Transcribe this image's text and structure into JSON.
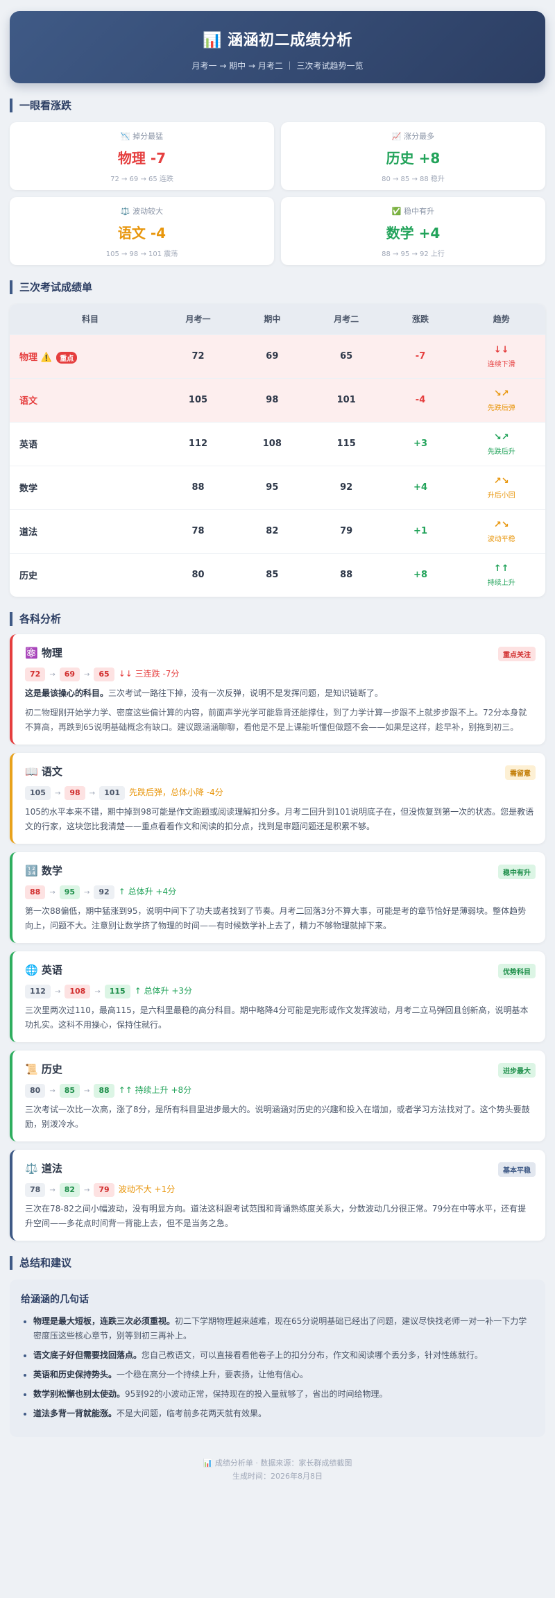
{
  "header": {
    "icon": "📊",
    "title": "涵涵初二成绩分析",
    "subtitle": "月考一 → 期中 → 月考二 ｜ 三次考试趋势一览"
  },
  "sections": {
    "overview": "一眼看涨跌",
    "table": "三次考试成绩单",
    "analysis": "各科分析",
    "summary": "总结和建议"
  },
  "stats": [
    {
      "icon": "📉",
      "label": "掉分最猛",
      "value": "物理 -7",
      "detail": "72 → 69 → 65 连跌",
      "color": "red"
    },
    {
      "icon": "📈",
      "label": "涨分最多",
      "value": "历史 +8",
      "detail": "80 → 85 → 88 稳升",
      "color": "green"
    },
    {
      "icon": "⚖️",
      "label": "波动较大",
      "value": "语文 -4",
      "detail": "105 → 98 → 101 震荡",
      "color": "orange"
    },
    {
      "icon": "✅",
      "label": "稳中有升",
      "value": "数学 +4",
      "detail": "88 → 95 → 92 上行",
      "color": "green"
    }
  ],
  "table": {
    "headers": [
      "科目",
      "月考一",
      "期中",
      "月考二",
      "涨跌",
      "趋势"
    ],
    "rows": [
      {
        "subject": "物理 ⚠️",
        "badge": "重点",
        "s1": "72",
        "s2": "69",
        "s3": "65",
        "change": "-7",
        "arrow": "↓↓",
        "trend": "连续下滑",
        "color": "red",
        "highlight": true
      },
      {
        "subject": "语文",
        "badge": "",
        "s1": "105",
        "s2": "98",
        "s3": "101",
        "change": "-4",
        "arrow": "↘↗",
        "trend": "先跌后弹",
        "color": "orange",
        "highlight": true
      },
      {
        "subject": "英语",
        "badge": "",
        "s1": "112",
        "s2": "108",
        "s3": "115",
        "change": "+3",
        "arrow": "↘↗",
        "trend": "先跌后升",
        "color": "green",
        "highlight": false
      },
      {
        "subject": "数学",
        "badge": "",
        "s1": "88",
        "s2": "95",
        "s3": "92",
        "change": "+4",
        "arrow": "↗↘",
        "trend": "升后小回",
        "color": "orange",
        "highlight": false
      },
      {
        "subject": "道法",
        "badge": "",
        "s1": "78",
        "s2": "82",
        "s3": "79",
        "change": "+1",
        "arrow": "↗↘",
        "trend": "波动平稳",
        "color": "orange",
        "highlight": false
      },
      {
        "subject": "历史",
        "badge": "",
        "s1": "80",
        "s2": "85",
        "s3": "88",
        "change": "+8",
        "arrow": "↑↑",
        "trend": "持续上升",
        "color": "green",
        "highlight": false
      }
    ]
  },
  "cards": [
    {
      "icon": "⚛️",
      "title": "物理",
      "tag": "重点关注",
      "theme": "red",
      "scores": [
        {
          "v": "72",
          "c": "r"
        },
        {
          "v": "69",
          "c": "r"
        },
        {
          "v": "65",
          "c": "r"
        }
      ],
      "conclusion": "↓↓ 三连跌 -7分",
      "conclusion_color": "red",
      "lead_bold": "这是最该操心的科目。",
      "lead_rest": "三次考试一路往下掉，没有一次反弹，说明不是发挥问题，是知识链断了。",
      "body": "初二物理刚开始学力学、密度这些偏计算的内容，前面声学光学可能靠背还能撑住，到了力学计算一步跟不上就步步跟不上。72分本身就不算高，再跌到65说明基础概念有缺口。建议跟涵涵聊聊，看他是不是上课能听懂但做题不会——如果是这样，趁早补，别拖到初三。"
    },
    {
      "icon": "📖",
      "title": "语文",
      "tag": "需留意",
      "theme": "orange",
      "scores": [
        {
          "v": "105",
          "c": "n"
        },
        {
          "v": "98",
          "c": "r"
        },
        {
          "v": "101",
          "c": "n"
        }
      ],
      "conclusion": "先跌后弹，总体小降 -4分",
      "conclusion_color": "orange",
      "lead_bold": "",
      "lead_rest": "",
      "body": "105的水平本来不错，期中掉到98可能是作文跑题或阅读理解扣分多。月考二回升到101说明底子在，但没恢复到第一次的状态。您是教语文的行家，这块您比我清楚——重点看看作文和阅读的扣分点，找到是审题问题还是积累不够。"
    },
    {
      "icon": "🔢",
      "title": "数学",
      "tag": "稳中有升",
      "theme": "green",
      "scores": [
        {
          "v": "88",
          "c": "r"
        },
        {
          "v": "95",
          "c": "g"
        },
        {
          "v": "92",
          "c": "n"
        }
      ],
      "conclusion": "↑ 总体升 +4分",
      "conclusion_color": "green",
      "lead_bold": "",
      "lead_rest": "",
      "body": "第一次88偏低，期中猛涨到95，说明中间下了功夫或者找到了节奏。月考二回落3分不算大事，可能是考的章节恰好是薄弱块。整体趋势向上，问题不大。注意别让数学挤了物理的时间——有时候数学补上去了，精力不够物理就掉下来。"
    },
    {
      "icon": "🌐",
      "title": "英语",
      "tag": "优势科目",
      "theme": "green",
      "scores": [
        {
          "v": "112",
          "c": "n"
        },
        {
          "v": "108",
          "c": "r"
        },
        {
          "v": "115",
          "c": "g"
        }
      ],
      "conclusion": "↑ 总体升 +3分",
      "conclusion_color": "green",
      "lead_bold": "",
      "lead_rest": "",
      "body": "三次里两次过110，最高115，是六科里最稳的高分科目。期中略降4分可能是完形或作文发挥波动，月考二立马弹回且创新高，说明基本功扎实。这科不用操心，保持住就行。"
    },
    {
      "icon": "📜",
      "title": "历史",
      "tag": "进步最大",
      "theme": "green",
      "scores": [
        {
          "v": "80",
          "c": "n"
        },
        {
          "v": "85",
          "c": "g"
        },
        {
          "v": "88",
          "c": "g"
        }
      ],
      "conclusion": "↑↑ 持续上升 +8分",
      "conclusion_color": "green",
      "lead_bold": "",
      "lead_rest": "",
      "body": "三次考试一次比一次高，涨了8分，是所有科目里进步最大的。说明涵涵对历史的兴趣和投入在增加，或者学习方法找对了。这个势头要鼓励，别泼冷水。"
    },
    {
      "icon": "⚖️",
      "title": "道法",
      "tag": "基本平稳",
      "theme": "blue",
      "scores": [
        {
          "v": "78",
          "c": "n"
        },
        {
          "v": "82",
          "c": "g"
        },
        {
          "v": "79",
          "c": "r"
        }
      ],
      "conclusion": "波动不大 +1分",
      "conclusion_color": "orange",
      "lead_bold": "",
      "lead_rest": "",
      "body": "三次在78-82之间小幅波动，没有明显方向。道法这科跟考试范围和背诵熟练度关系大，分数波动几分很正常。79分在中等水平，还有提升空间——多花点时间背一背能上去，但不是当务之急。"
    }
  ],
  "summary": {
    "title": "给涵涵的几句话",
    "items": [
      {
        "bold": "物理是最大短板，连跌三次必须重视。",
        "rest": "初二下学期物理越来越难，现在65分说明基础已经出了问题，建议尽快找老师一对一补一下力学密度压这些核心章节，别等到初三再补上。"
      },
      {
        "bold": "语文底子好但需要找回落点。",
        "rest": "您自己教语文，可以直接看看他卷子上的扣分分布，作文和阅读哪个丢分多，针对性练就行。"
      },
      {
        "bold": "英语和历史保持势头。",
        "rest": "一个稳在高分一个持续上升，要表扬，让他有信心。"
      },
      {
        "bold": "数学别松懈也别太使劲。",
        "rest": "95到92的小波动正常，保持现在的投入量就够了，省出的时间给物理。"
      },
      {
        "bold": "道法多背一背就能涨。",
        "rest": "不是大问题，临考前多花两天就有效果。"
      }
    ]
  },
  "footer": {
    "line1": "📊 成绩分析单 · 数据来源：家长群成绩截图",
    "line2": "生成时间：2026年8月8日"
  },
  "colors": {
    "accent": "#3f5a86",
    "red": "#e53e3e",
    "green": "#22a35a",
    "orange": "#e8960c"
  }
}
